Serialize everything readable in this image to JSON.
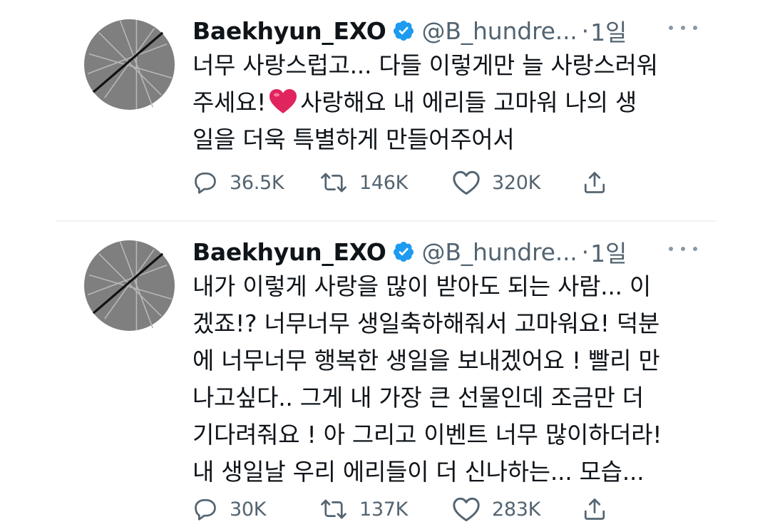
{
  "colors": {
    "text": "#0f1419",
    "secondary": "#536471",
    "verified": "#1d9bf0",
    "heart": "#e0245e"
  },
  "tweets": [
    {
      "author": {
        "name": "Baekhyun_EXO",
        "handle": "@B_hundre...",
        "verified": true,
        "avatar_icon": "exo-logo-avatar-icon"
      },
      "separator": "·",
      "time": "1일",
      "more_icon": "more-dots-icon",
      "text_lines": [
        "너무 사랑스럽고... 다들 이렇게만 늘 사랑스러워",
        {
          "before": "주세요!",
          "emoji": "red-heart-icon",
          "after": "사랑해요 내 에리들 고마워 나의 생"
        },
        "일을 더욱 특별하게 만들어주어서"
      ],
      "stats": {
        "replies": "36.5K",
        "retweets": "146K",
        "likes": "320K"
      }
    },
    {
      "author": {
        "name": "Baekhyun_EXO",
        "handle": "@B_hundre...",
        "verified": true,
        "avatar_icon": "exo-logo-avatar-icon"
      },
      "separator": "·",
      "time": "1일",
      "more_icon": "more-dots-icon",
      "text_lines": [
        "내가 이렇게 사랑을 많이 받아도 되는 사람... 이",
        "겠죠!? 너무너무 생일축하해줘서 고마워요! 덕분",
        "에 너무너무 행복한 생일을 보내겠어요 ! 빨리 만",
        "나고싶다.. 그게 내 가장 큰 선물인데 조금만 더",
        "기다려줘요 ! 아 그리고 이벤트 너무 많이하더라!",
        "내 생일날 우리 에리들이 더 신나하는... 모습..."
      ],
      "stats": {
        "replies": "30K",
        "retweets": "137K",
        "likes": "283K"
      }
    }
  ]
}
